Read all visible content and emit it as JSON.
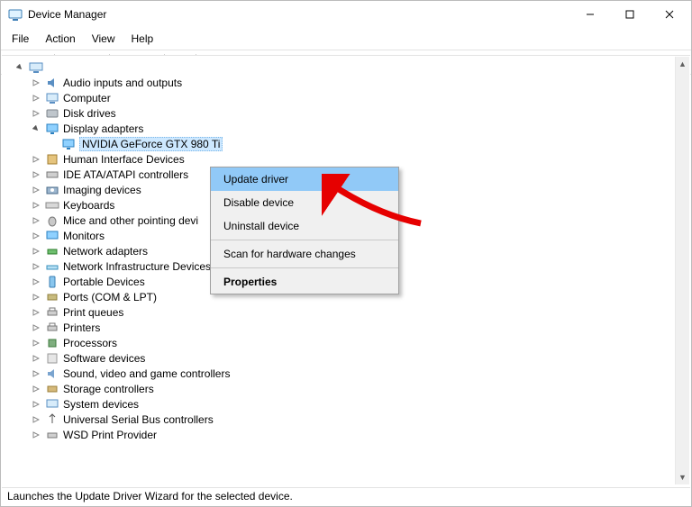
{
  "window": {
    "title": "Device Manager"
  },
  "menu": {
    "file": "File",
    "action": "Action",
    "view": "View",
    "help": "Help"
  },
  "tree": {
    "root": "",
    "display_adapters": "Display adapters",
    "selected_device": "NVIDIA GeForce GTX 980 Ti",
    "items": {
      "audio": "Audio inputs and outputs",
      "computer": "Computer",
      "disk": "Disk drives",
      "hid": "Human Interface Devices",
      "ide": "IDE ATA/ATAPI controllers",
      "imaging": "Imaging devices",
      "keyboards": "Keyboards",
      "mice": "Mice and other pointing devi",
      "monitors": "Monitors",
      "network": "Network adapters",
      "netinfra": "Network Infrastructure Devices",
      "portable": "Portable Devices",
      "ports": "Ports (COM & LPT)",
      "queues": "Print queues",
      "printers": "Printers",
      "processors": "Processors",
      "software": "Software devices",
      "sound": "Sound, video and game controllers",
      "storage": "Storage controllers",
      "system": "System devices",
      "usb": "Universal Serial Bus controllers",
      "wsd": "WSD Print Provider"
    }
  },
  "ctx": {
    "update": "Update driver",
    "disable": "Disable device",
    "uninstall": "Uninstall device",
    "scan": "Scan for hardware changes",
    "properties": "Properties"
  },
  "status": "Launches the Update Driver Wizard for the selected device."
}
